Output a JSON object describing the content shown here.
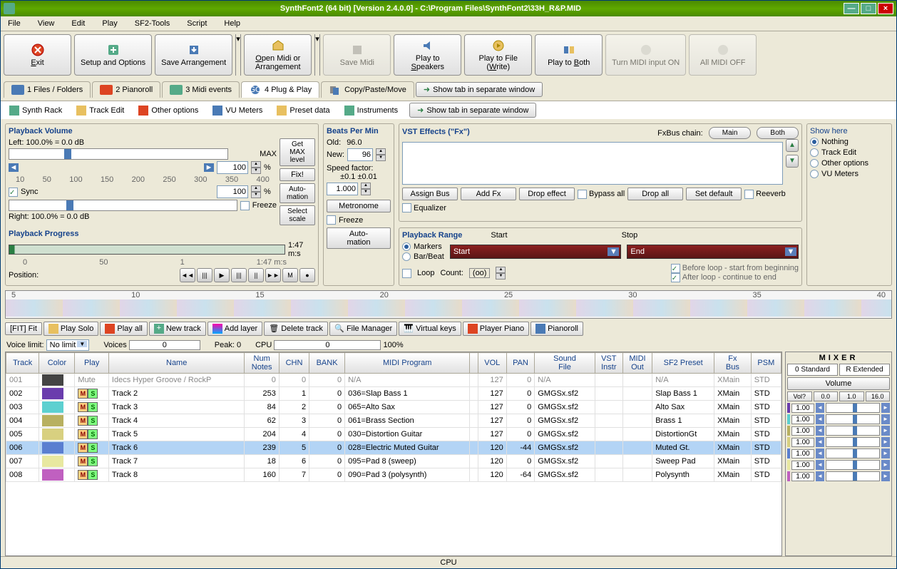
{
  "window": {
    "title": "SynthFont2 (64 bit) [Version 2.4.0.0] - C:\\Program Files\\SynthFont2\\33H_R&P.MID"
  },
  "menu": [
    "File",
    "View",
    "Edit",
    "Play",
    "SF2-Tools",
    "Script",
    "Help"
  ],
  "toolbar": {
    "exit": "Exit",
    "setup": "Setup and\nOptions",
    "save": "Save\nArrangement",
    "open": "Open Midi or\nArrangement",
    "savemidi": "Save Midi",
    "speakers": "Play to\nSpeakers",
    "file": "Play to File\n(Write)",
    "both": "Play to Both",
    "midion": "Turn MIDI\ninput ON",
    "allmidi": "All MIDI OFF"
  },
  "mainTabs": {
    "files": "1 Files / Folders",
    "pianoroll": "2 Pianoroll",
    "midi": "3 Midi events",
    "plug": "4 Plug & Play",
    "copy": "Copy/Paste/Move",
    "separate": "Show tab in separate window"
  },
  "subTabs": {
    "synth": "Synth Rack",
    "track": "Track Edit",
    "other": "Other options",
    "vu": "VU Meters",
    "preset": "Preset data",
    "instr": "Instruments",
    "separate": "Show tab in separate window"
  },
  "pv": {
    "title": "Playback Volume",
    "left": "Left: 100.0% = 0.0 dB",
    "right": "Right: 100.0% = 0.0 dB",
    "max": "MAX",
    "sync": "Sync",
    "freeze": "Freeze",
    "vol1": "100",
    "vol2": "100",
    "getmax": "Get\nMAX\nlevel",
    "fixl": "Fix!",
    "auto": "Auto-\nmation",
    "scale": "Select\nscale",
    "ticks": [
      "10",
      "50",
      "100",
      "150",
      "200",
      "250",
      "300",
      "350",
      "400"
    ],
    "progress": "Playback Progress",
    "time": "1:47 m:s",
    "position": "Position:"
  },
  "bpm": {
    "title": "Beats Per Min",
    "old": "Old:",
    "oldv": "96.0",
    "new": "New:",
    "newv": "96",
    "speed": "Speed factor:",
    "pm": "±0.1   ±0.01",
    "val": "1.000",
    "metro": "Metronome",
    "freeze": "Freeze",
    "auto": "Auto-\nmation"
  },
  "fx": {
    "title": "VST Effects (\"Fx\")",
    "chain": "FxBus chain:",
    "main": "Main",
    "both": "Both",
    "assign": "Assign Bus",
    "addfx": "Add Fx",
    "drop": "Drop effect",
    "bypass": "Bypass all",
    "dropall": "Drop all",
    "setdef": "Set default",
    "reverb": "Reeverb",
    "eq": "Equalizer"
  },
  "range": {
    "title": "Playback Range",
    "start": "Start",
    "stop": "Stop",
    "markers": "Markers",
    "barbeat": "Bar/Beat",
    "startv": "Start",
    "endv": "End",
    "loop": "Loop",
    "count": "Count:",
    "countv": "(oo)",
    "before": "Before loop - start from beginning",
    "after": "After loop - continue to end"
  },
  "show": {
    "title": "Show here",
    "nothing": "Nothing",
    "track": "Track Edit",
    "other": "Other options",
    "vu": "VU Meters"
  },
  "timeline": {
    "marks": [
      "5",
      "10",
      "15",
      "20",
      "25",
      "30",
      "35",
      "40"
    ]
  },
  "tt": {
    "fit": "[FIT] Fit",
    "solo": "Play Solo",
    "all": "Play all",
    "new": "New track",
    "layer": "Add layer",
    "del": "Delete track",
    "fm": "File Manager",
    "vk": "Virtual keys",
    "pp": "Player Piano",
    "pr": "Pianoroll"
  },
  "filter": {
    "voice": "Voice limit:",
    "nolimit": "No limit",
    "voices": "Voices",
    "voicesv": "0",
    "peak": "Peak: 0",
    "cpu": "CPU",
    "cpuv": "0",
    "pct100": "100%"
  },
  "cols": [
    "Track",
    "Color",
    "Play",
    "Name",
    "Num\nNotes",
    "CHN",
    "BANK",
    "MIDI Program",
    "",
    "VOL",
    "PAN",
    "Sound\nFile",
    "VST\nInstr",
    "MIDI\nOut",
    "SF2 Preset",
    "Fx\nBus",
    "PSM"
  ],
  "rows": [
    {
      "trk": "001",
      "color": "#444",
      "mute": true,
      "name": "Idecs Hyper Groove / RockP",
      "notes": "0",
      "chn": "0",
      "bank": "0",
      "prog": "N/A",
      "vol": "127",
      "pan": "0",
      "sf": "N/A",
      "preset": "N/A",
      "bus": "XMain",
      "psm": "STD"
    },
    {
      "trk": "002",
      "color": "#6a3dad",
      "name": "Track 2",
      "notes": "253",
      "chn": "1",
      "bank": "0",
      "prog": "036=Slap Bass 1",
      "vol": "127",
      "pan": "0",
      "sf": "GMGSx.sf2",
      "preset": "Slap Bass 1",
      "bus": "XMain",
      "psm": "STD"
    },
    {
      "trk": "003",
      "color": "#5dd0d0",
      "name": "Track 3",
      "notes": "84",
      "chn": "2",
      "bank": "0",
      "prog": "065=Alto Sax",
      "vol": "127",
      "pan": "0",
      "sf": "GMGSx.sf2",
      "preset": "Alto Sax",
      "bus": "XMain",
      "psm": "STD"
    },
    {
      "trk": "004",
      "color": "#b8b060",
      "name": "Track 4",
      "notes": "62",
      "chn": "3",
      "bank": "0",
      "prog": "061=Brass Section",
      "vol": "127",
      "pan": "0",
      "sf": "GMGSx.sf2",
      "preset": "Brass 1",
      "bus": "XMain",
      "psm": "STD"
    },
    {
      "trk": "005",
      "color": "#d8d080",
      "name": "Track 5",
      "notes": "204",
      "chn": "4",
      "bank": "0",
      "prog": "030=Distortion Guitar",
      "vol": "127",
      "pan": "0",
      "sf": "GMGSx.sf2",
      "preset": "DistortionGt",
      "bus": "XMain",
      "psm": "STD"
    },
    {
      "trk": "006",
      "color": "#5a7ed0",
      "sel": true,
      "name": "Track 6",
      "notes": "239",
      "chn": "5",
      "bank": "0",
      "prog": "028=Electric Muted Guitar",
      "vol": "120",
      "pan": "-44",
      "sf": "GMGSx.sf2",
      "preset": "Muted Gt.",
      "bus": "XMain",
      "psm": "STD"
    },
    {
      "trk": "007",
      "color": "#e8e8a0",
      "name": "Track 7",
      "notes": "18",
      "chn": "6",
      "bank": "0",
      "prog": "095=Pad 8 (sweep)",
      "vol": "120",
      "pan": "0",
      "sf": "GMGSx.sf2",
      "preset": "Sweep Pad",
      "bus": "XMain",
      "psm": "STD"
    },
    {
      "trk": "008",
      "color": "#c060c0",
      "name": "Track 8",
      "notes": "160",
      "chn": "7",
      "bank": "0",
      "prog": "090=Pad 3 (polysynth)",
      "vol": "120",
      "pan": "-64",
      "sf": "GMGSx.sf2",
      "preset": "Polysynth",
      "bus": "XMain",
      "psm": "STD"
    }
  ],
  "mixer": {
    "title": "MIXER",
    "std": "0 Standard",
    "ext": "R Extended",
    "volume": "Volume",
    "btns": [
      "Vol?",
      "0.0",
      "1.0",
      "16.0"
    ],
    "rows": [
      {
        "v": "1.00",
        "c": "#6a3dad"
      },
      {
        "v": "1.00",
        "c": "#5dd0d0"
      },
      {
        "v": "1.00",
        "c": "#b8b060"
      },
      {
        "v": "1.00",
        "c": "#d8d080"
      },
      {
        "v": "1.00",
        "c": "#5a7ed0"
      },
      {
        "v": "1.00",
        "c": "#e8e8a0"
      },
      {
        "v": "1.00",
        "c": "#c060c0"
      }
    ]
  },
  "status": "CPU"
}
